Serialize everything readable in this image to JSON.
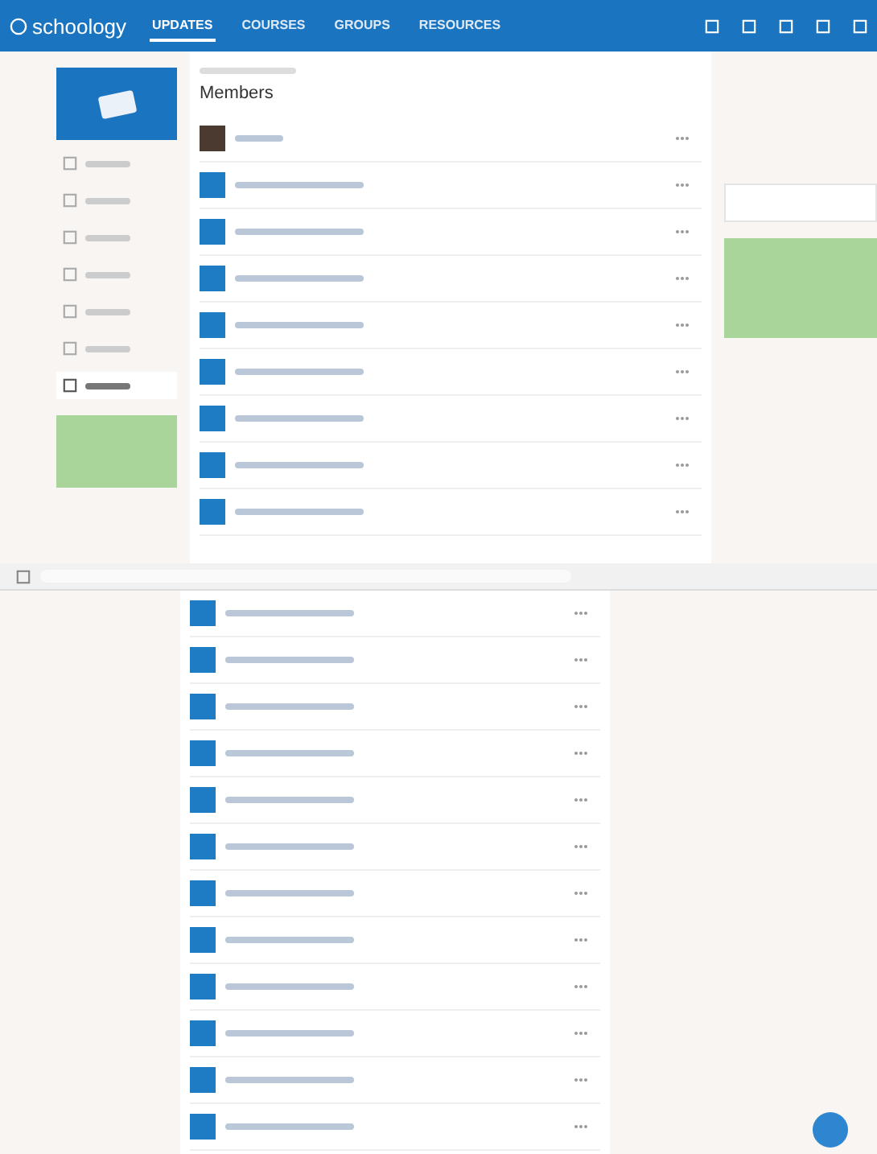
{
  "top_screen": {
    "brand": "schoology",
    "nav_tabs": [
      {
        "label": "UPDATES",
        "selected": true
      },
      {
        "label": "COURSES",
        "selected": false
      },
      {
        "label": "GROUPS",
        "selected": false
      },
      {
        "label": "RESOURCES",
        "selected": false
      }
    ],
    "page_title": "Members",
    "sidebar_items": [
      {
        "selected": false
      },
      {
        "selected": false
      },
      {
        "selected": false
      },
      {
        "selected": false
      },
      {
        "selected": false
      },
      {
        "selected": false
      },
      {
        "selected": true
      }
    ],
    "members": [
      {
        "kind": "photo"
      },
      {
        "kind": "default"
      },
      {
        "kind": "default"
      },
      {
        "kind": "default"
      },
      {
        "kind": "default"
      },
      {
        "kind": "default"
      },
      {
        "kind": "default"
      },
      {
        "kind": "default"
      },
      {
        "kind": "default"
      }
    ]
  },
  "bottom_screen": {
    "members": [
      {
        "kind": "default"
      },
      {
        "kind": "default"
      },
      {
        "kind": "default"
      },
      {
        "kind": "default"
      },
      {
        "kind": "default"
      },
      {
        "kind": "default"
      },
      {
        "kind": "default"
      },
      {
        "kind": "default"
      },
      {
        "kind": "default"
      },
      {
        "kind": "default"
      },
      {
        "kind": "default"
      },
      {
        "kind": "default"
      }
    ]
  }
}
